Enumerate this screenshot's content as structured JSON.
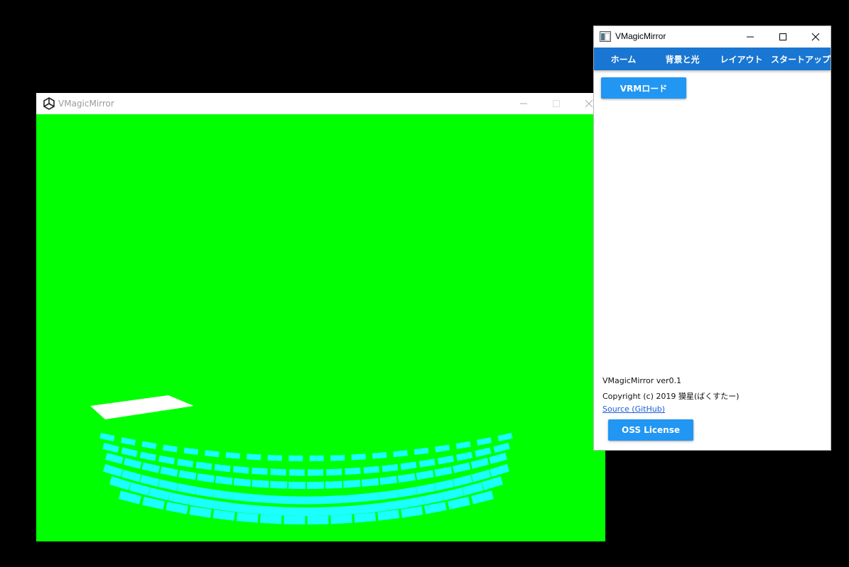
{
  "unity_window": {
    "title": "VMagicMirror",
    "background_color": "#00ff00",
    "keyboard_color": "#1bffff",
    "touchpad_color": "#ffffff",
    "icons": [
      "unity-logo-icon",
      "minimize-icon",
      "maximize-icon",
      "close-icon"
    ]
  },
  "panel_window": {
    "title": "VMagicMirror",
    "accent_color": "#1976d2",
    "button_color": "#2196f3",
    "tabs": [
      {
        "label": "ホーム"
      },
      {
        "label": "背景と光"
      },
      {
        "label": "レイアウト"
      },
      {
        "label": "スタートアップ"
      }
    ],
    "load_vrm_label": "VRMロード",
    "version_text": "VMagicMirror ver0.1",
    "copyright_text": "Copyright (c) 2019 獏星(ばくすたー)",
    "source_link": "Source (GitHub)",
    "oss_license_label": "OSS License"
  }
}
